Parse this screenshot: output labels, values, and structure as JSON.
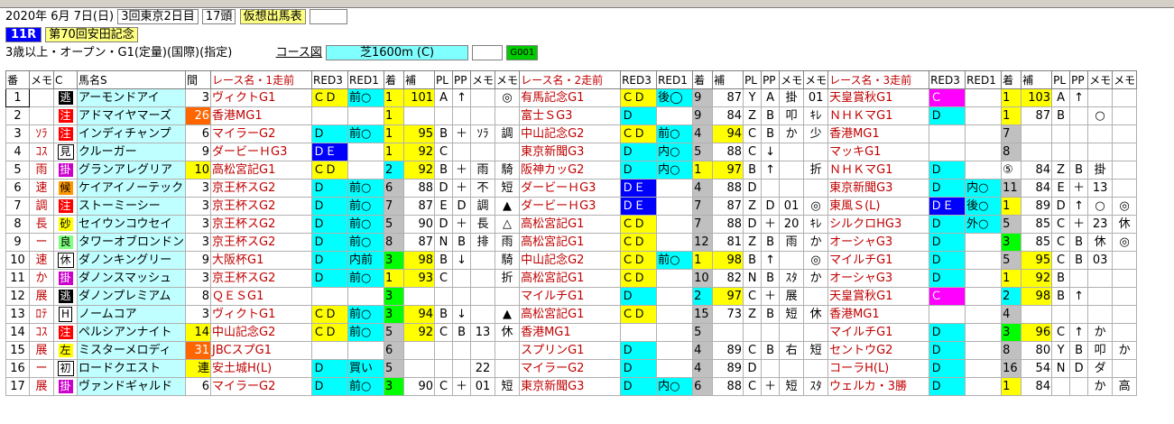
{
  "header": {
    "date": "2020年 6月 7日(日)",
    "meeting": "3回東京2日目",
    "runners": "17頭",
    "mode": "仮想出馬表",
    "race_no": "11R",
    "race_name": "第70回安田記念",
    "conditions": "3歳以上・オープン・G1(定量)(国際)(指定)",
    "course_label": "コース図",
    "course": "芝1600m (C)",
    "code": "G001"
  },
  "columns": [
    "番",
    "メモ",
    "C",
    "馬名S",
    "間",
    "レース名・1走前",
    "RED3",
    "RED1",
    "着",
    "補",
    "PL",
    "PP",
    "メモ",
    "メモ",
    "レース名・2走前",
    "RED3",
    "RED1",
    "着",
    "補",
    "PL",
    "PP",
    "メモ",
    "メモ",
    "レース名・3走前",
    "RED3",
    "RED1",
    "着",
    "補",
    "PL",
    "PP",
    "メモ",
    "メモ"
  ],
  "rows": [
    {
      "no": "1",
      "memo": "",
      "c": "逃",
      "name": "アーモンドアイ",
      "int": "3",
      "r1": [
        "ヴィクトG1",
        "ＣＤ",
        "前○",
        "1",
        "101",
        "A",
        "↑",
        "",
        "◎"
      ],
      "r2": [
        "有馬記念G1",
        "ＣＤ",
        "後◯",
        "9",
        "87",
        "Y",
        "A",
        "掛",
        "01"
      ],
      "r3": [
        "天皇賞秋G1",
        "Ｃ",
        "",
        "1",
        "103",
        "A",
        "↑",
        "",
        ""
      ]
    },
    {
      "no": "2",
      "memo": "",
      "c": "注",
      "name": "アドマイヤマーズ",
      "int": "26",
      "r1": [
        "香港MG1",
        "",
        "",
        "1",
        "",
        "",
        "",
        "",
        ""
      ],
      "r2": [
        "富士ＳG3",
        "Ｄ",
        "",
        "9",
        "84",
        "Z",
        "B",
        "叩",
        "ｷﾚ"
      ],
      "r3": [
        "ＮＨＫマG1",
        "Ｄ",
        "",
        "1",
        "87",
        "B",
        "",
        "○",
        ""
      ]
    },
    {
      "no": "3",
      "memo": "ｿﾗ",
      "c": "注",
      "name": "インディチャンプ",
      "int": "6",
      "r1": [
        "マイラーG2",
        "Ｄ",
        "前○",
        "1",
        "95",
        "B",
        "＋",
        "ｿﾗ",
        "調"
      ],
      "r2": [
        "中山記念G2",
        "ＣＤ",
        "前○",
        "4",
        "94",
        "C",
        "B",
        "か",
        "少"
      ],
      "r3": [
        "香港MG1",
        "",
        "",
        "7",
        "",
        "",
        "",
        "",
        ""
      ]
    },
    {
      "no": "4",
      "memo": "ｺｽ",
      "c": "見",
      "name": "クルーガー",
      "int": "9",
      "r1": [
        "ダービーＨG3",
        "ＤＥ",
        "",
        "1",
        "92",
        "C",
        "",
        "",
        ""
      ],
      "r2": [
        "東京新聞G3",
        "Ｄ",
        "内○",
        "5",
        "88",
        "C",
        "↓",
        "",
        ""
      ],
      "r3": [
        "マッキG1",
        "",
        "",
        "8",
        "",
        "",
        "",
        "",
        ""
      ]
    },
    {
      "no": "5",
      "memo": "雨",
      "c": "掛",
      "name": "グランアレグリア",
      "int": "10",
      "r1": [
        "高松宮記G1",
        "ＣＤ",
        "",
        "2",
        "92",
        "B",
        "＋",
        "雨",
        "騎"
      ],
      "r2": [
        "阪神カッG2",
        "Ｄ",
        "内○",
        "1",
        "97",
        "B",
        "↑",
        "",
        "折"
      ],
      "r3": [
        "ＮＨＫマG1",
        "Ｄ",
        "",
        "⑤",
        "84",
        "Z",
        "B",
        "掛",
        ""
      ]
    },
    {
      "no": "6",
      "memo": "速",
      "c": "候",
      "name": "ケイアイノーテック",
      "int": "3",
      "r1": [
        "京王杯スG2",
        "Ｄ",
        "前○",
        "6",
        "88",
        "D",
        "＋",
        "不",
        "短"
      ],
      "r2": [
        "ダービーＨG3",
        "ＤＥ",
        "",
        "4",
        "88",
        "D",
        "",
        "",
        ""
      ],
      "r3": [
        "東京新聞G3",
        "Ｄ",
        "内○",
        "11",
        "84",
        "E",
        "＋",
        "13",
        ""
      ]
    },
    {
      "no": "7",
      "memo": "調",
      "c": "注",
      "name": "ストーミーシー",
      "int": "3",
      "r1": [
        "京王杯スG2",
        "Ｄ",
        "前○",
        "7",
        "87",
        "E",
        "D",
        "調",
        "▲"
      ],
      "r2": [
        "ダービーＨG3",
        "ＤＥ",
        "",
        "7",
        "87",
        "Z",
        "D",
        "01",
        "◎"
      ],
      "r3": [
        "東風Ｓ(L)",
        "ＤＥ",
        "後○",
        "1",
        "89",
        "D",
        "↑",
        "○",
        "◎"
      ]
    },
    {
      "no": "8",
      "memo": "長",
      "c": "砂",
      "name": "セイウンコウセイ",
      "int": "3",
      "r1": [
        "京王杯スG2",
        "Ｄ",
        "前○",
        "5",
        "90",
        "D",
        "＋",
        "長",
        "△"
      ],
      "r2": [
        "高松宮記G1",
        "ＣＤ",
        "",
        "7",
        "88",
        "D",
        "＋",
        "20",
        "ｷﾚ"
      ],
      "r3": [
        "シルクロHG3",
        "Ｄ",
        "外○",
        "5",
        "85",
        "C",
        "＋",
        "23",
        "休"
      ]
    },
    {
      "no": "9",
      "memo": "ー",
      "c": "良",
      "name": "タワーオブロンドン",
      "int": "3",
      "r1": [
        "京王杯スG2",
        "Ｄ",
        "前○",
        "8",
        "87",
        "N",
        "B",
        "排",
        "雨"
      ],
      "r2": [
        "高松宮記G1",
        "ＣＤ",
        "",
        "12",
        "81",
        "Z",
        "B",
        "雨",
        "か"
      ],
      "r3": [
        "オーシャG3",
        "Ｄ",
        "",
        "3",
        "85",
        "C",
        "B",
        "休",
        "◎"
      ]
    },
    {
      "no": "10",
      "memo": "速",
      "c": "休",
      "name": "ダノンキングリー",
      "int": "9",
      "r1": [
        "大阪杯G1",
        "Ｄ",
        "内前",
        "3",
        "98",
        "B",
        "↓",
        "",
        "騎"
      ],
      "r2": [
        "中山記念G2",
        "ＣＤ",
        "前○",
        "1",
        "98",
        "B",
        "↑",
        "",
        "◎"
      ],
      "r3": [
        "マイルチG1",
        "Ｄ",
        "",
        "5",
        "95",
        "C",
        "B",
        "03",
        ""
      ]
    },
    {
      "no": "11",
      "memo": "か",
      "c": "掛",
      "name": "ダノンスマッシュ",
      "int": "3",
      "r1": [
        "京王杯スG2",
        "Ｄ",
        "前○",
        "1",
        "93",
        "C",
        "",
        "",
        "折"
      ],
      "r2": [
        "高松宮記G1",
        "ＣＤ",
        "",
        "10",
        "82",
        "N",
        "B",
        "ｽﾀ",
        "か"
      ],
      "r3": [
        "オーシャG3",
        "Ｄ",
        "",
        "1",
        "92",
        "B",
        "",
        "",
        ""
      ]
    },
    {
      "no": "12",
      "memo": "展",
      "c": "逃",
      "name": "ダノンプレミアム",
      "int": "8",
      "r1": [
        "ＱＥＳG1",
        "",
        "",
        "3",
        "",
        "",
        "",
        "",
        ""
      ],
      "r2": [
        "マイルチG1",
        "Ｄ",
        "",
        "2",
        "97",
        "C",
        "＋",
        "展",
        ""
      ],
      "r3": [
        "天皇賞秋G1",
        "Ｃ",
        "",
        "2",
        "98",
        "B",
        "↑",
        "",
        ""
      ]
    },
    {
      "no": "13",
      "memo": "ﾛﾃ",
      "c": "H",
      "name": "ノームコア",
      "int": "3",
      "r1": [
        "ヴィクトG1",
        "ＣＤ",
        "前○",
        "3",
        "94",
        "B",
        "↓",
        "",
        "▲"
      ],
      "r2": [
        "高松宮記G1",
        "ＣＤ",
        "",
        "15",
        "73",
        "Z",
        "B",
        "短",
        "休"
      ],
      "r3": [
        "香港MG1",
        "",
        "",
        "4",
        "",
        "",
        "",
        "",
        ""
      ]
    },
    {
      "no": "14",
      "memo": "ｺｽ",
      "c": "注",
      "name": "ペルシアンナイト",
      "int": "14",
      "r1": [
        "中山記念G2",
        "ＣＤ",
        "前○",
        "5",
        "92",
        "C",
        "B",
        "13",
        "休"
      ],
      "r2": [
        "香港MG1",
        "",
        "",
        "5",
        "",
        "",
        "",
        "",
        ""
      ],
      "r3": [
        "マイルチG1",
        "Ｄ",
        "",
        "3",
        "96",
        "C",
        "↑",
        "か",
        ""
      ]
    },
    {
      "no": "15",
      "memo": "展",
      "c": "左",
      "name": "ミスターメロディ",
      "int": "31",
      "r1": [
        "JBCスプG1",
        "",
        "",
        "6",
        "",
        "",
        "",
        "",
        ""
      ],
      "r2": [
        "スプリンG1",
        "Ｄ",
        "",
        "4",
        "89",
        "C",
        "B",
        "右",
        "短"
      ],
      "r3": [
        "セントウG2",
        "Ｄ",
        "",
        "8",
        "80",
        "Y",
        "B",
        "叩",
        "か"
      ]
    },
    {
      "no": "16",
      "memo": "ー",
      "c": "初",
      "name": "ロードクエスト",
      "int": "連",
      "r1": [
        "安土城H(L)",
        "Ｄ",
        "買い",
        "5",
        "",
        "",
        "",
        "22",
        ""
      ],
      "r2": [
        "マイラーG2",
        "Ｄ",
        "",
        "4",
        "89",
        "D",
        "",
        "",
        ""
      ],
      "r3": [
        "コーラH(L)",
        "Ｄ",
        "",
        "16",
        "54",
        "N",
        "D",
        "ダ",
        ""
      ]
    },
    {
      "no": "17",
      "memo": "展",
      "c": "掛",
      "name": "ヴァンドギャルド",
      "int": "6",
      "r1": [
        "マイラーG2",
        "Ｄ",
        "前○",
        "3",
        "90",
        "C",
        "＋",
        "01",
        "短"
      ],
      "r2": [
        "東京新聞G3",
        "Ｄ",
        "内○",
        "6",
        "88",
        "C",
        "＋",
        "短",
        "ｽﾀ"
      ],
      "r3": [
        "ウェルカ・3勝",
        "Ｄ",
        "",
        "1",
        "84",
        "",
        "",
        "か",
        "高"
      ]
    }
  ]
}
